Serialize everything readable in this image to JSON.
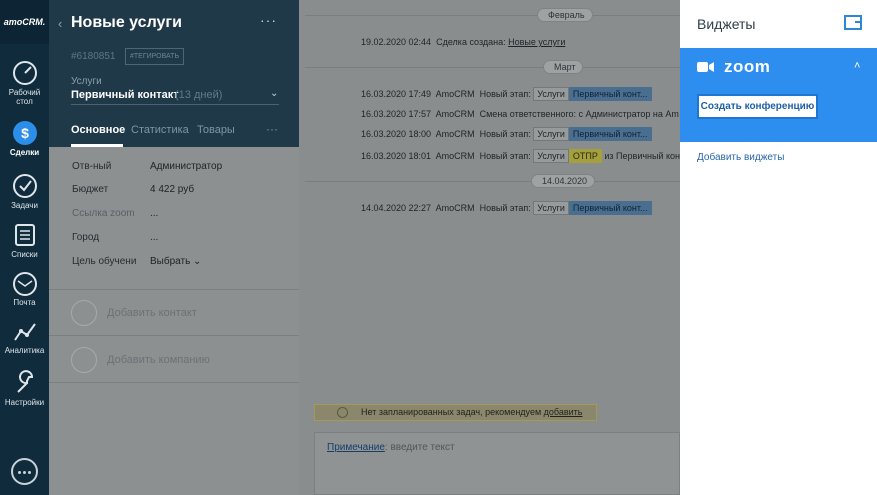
{
  "nav": {
    "logo": "amoCRM.",
    "items": [
      {
        "label": "Рабочий стол"
      },
      {
        "label": "Сделки"
      },
      {
        "label": "Задачи"
      },
      {
        "label": "Списки"
      },
      {
        "label": "Почта"
      },
      {
        "label": "Аналитика"
      },
      {
        "label": "Настройки"
      }
    ]
  },
  "deal": {
    "back": "‹",
    "title": "Новые услуги",
    "menu": "···",
    "id": "#6180851",
    "tag_button": "#ТЕГИРОВАТЬ",
    "pipeline_label": "Услуги",
    "stage": "Первичный контакт",
    "stage_days": "(13 дней)",
    "tabs": [
      "Основное",
      "Статистика",
      "Товары"
    ],
    "tabs_more": "···"
  },
  "fields": [
    {
      "label": "Отв-ный",
      "value": "Администратор"
    },
    {
      "label": "Бюджет",
      "value": "4 422 руб"
    },
    {
      "label": "Ссылка zoom",
      "value": "..."
    },
    {
      "label": "Город",
      "value": "..."
    },
    {
      "label": "Цель обучени",
      "value": "Выбрать"
    }
  ],
  "actions": {
    "add_contact": "Добавить контакт",
    "add_company": "Добавить компанию"
  },
  "feed": {
    "dates": [
      "Февраль",
      "Март",
      "14.04.2020"
    ],
    "events": [
      {
        "time": "19.02.2020 02:44",
        "text": "Сделка создана:",
        "link": "Новые услуги"
      },
      {
        "time": "16.03.2020 17:49",
        "author": "AmoCRM",
        "text": "Новый этап:",
        "chip1": "Услуги",
        "chip2": "Первичный конт..."
      },
      {
        "time": "16.03.2020 17:57",
        "author": "AmoCRM",
        "text": "Смена ответственного: с Администратор на Am"
      },
      {
        "time": "16.03.2020 18:00",
        "author": "AmoCRM",
        "text": "Новый этап:",
        "chip1": "Услуги",
        "chip2": "Первичный конт..."
      },
      {
        "time": "16.03.2020 18:01",
        "author": "AmoCRM",
        "text": "Новый этап:",
        "chip1": "Услуги",
        "chip2": "ОТПР",
        "tail": "из Первичный конт"
      },
      {
        "time": "14.04.2020 22:27",
        "author": "AmoCRM",
        "text": "Новый этап:",
        "chip1": "Услуги",
        "chip2": "Первичный конт..."
      }
    ],
    "task_text": "Нет запланированных задач, рекомендуем",
    "task_link": "добавить",
    "note_link": "Примечание",
    "note_placeholder": ": введите текст"
  },
  "widgets": {
    "title": "Виджеты",
    "zoom_name": "zoom",
    "zoom_caret": "˄",
    "create_conf": "Создать конференцию",
    "add_widgets": "Добавить виджеты"
  },
  "colors": {
    "nav": "#0f2b3c",
    "header": "#1f3949",
    "zoom_blue": "#2d8ef0",
    "link": "#2766a8"
  }
}
